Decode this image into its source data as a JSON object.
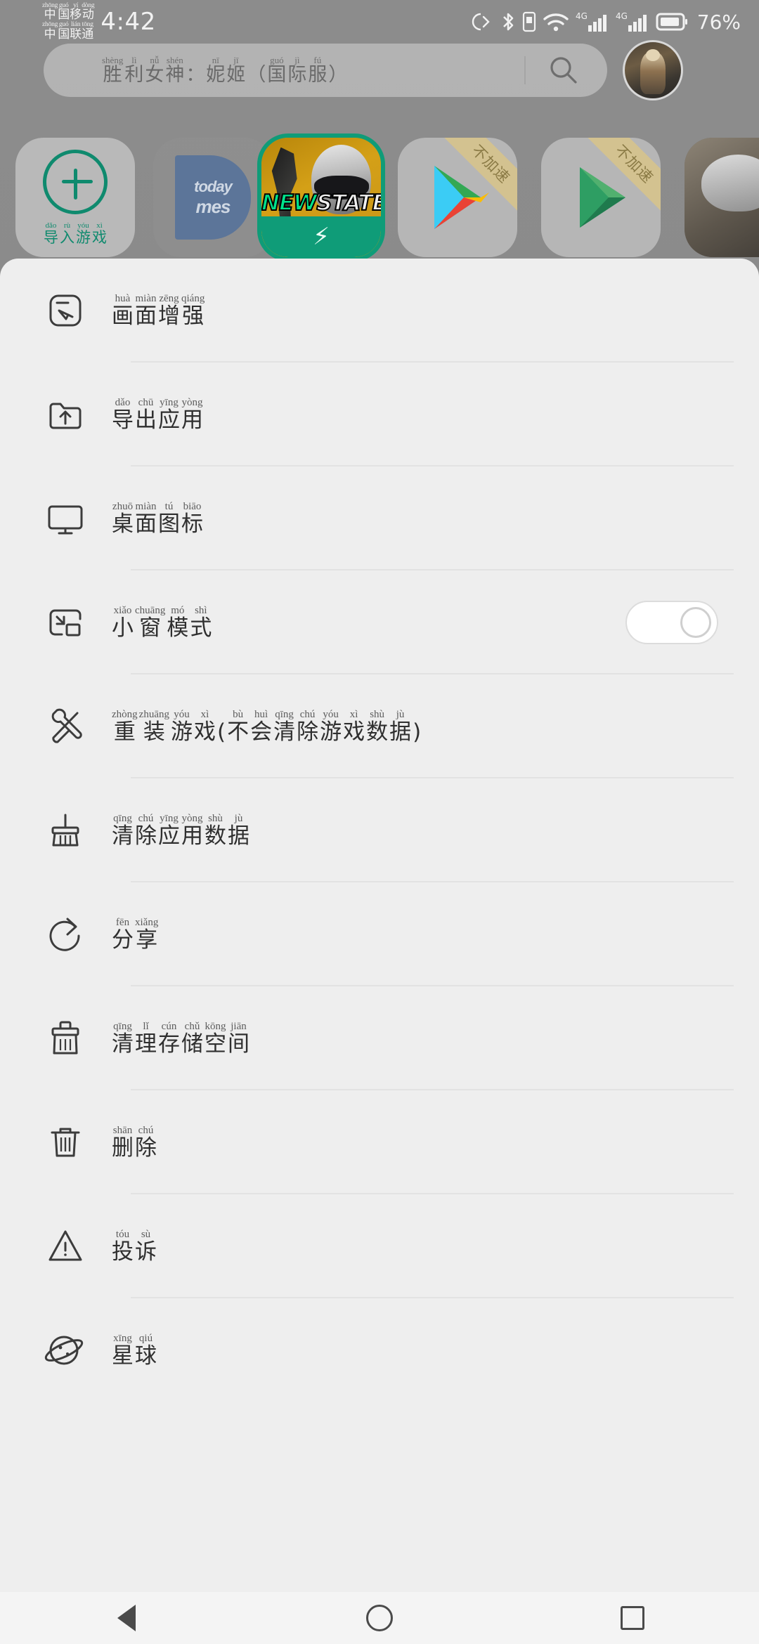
{
  "status_bar": {
    "carriers": [
      {
        "pinyin": [
          "zhōng",
          "guó",
          "yí",
          "dòng"
        ],
        "han": [
          "中",
          "国",
          "移",
          "动"
        ]
      },
      {
        "pinyin": [
          "zhōng",
          "guó",
          "lián",
          "tōng"
        ],
        "han": [
          "中",
          "国",
          "联",
          "通"
        ]
      }
    ],
    "time": "4:42",
    "battery_percent": "76%",
    "icons": [
      "do-not-disturb-icon",
      "bluetooth-icon",
      "wifi-icon",
      "signal-4g-1-icon",
      "signal-4g-2-icon",
      "battery-icon"
    ],
    "network_label": "4G"
  },
  "search": {
    "ruby": [
      {
        "py": "shèng",
        "han": "胜"
      },
      {
        "py": "lì",
        "han": "利"
      },
      {
        "py": "nǚ",
        "han": "女"
      },
      {
        "py": "shén",
        "han": "神"
      },
      {
        "py": "",
        "han": "："
      },
      {
        "py": "nī",
        "han": "妮"
      },
      {
        "py": "jī",
        "han": "姬"
      },
      {
        "py": "",
        "han": "（"
      },
      {
        "py": "guó",
        "han": "国"
      },
      {
        "py": "jì",
        "han": "际"
      },
      {
        "py": "fú",
        "han": "服"
      },
      {
        "py": "",
        "han": "）"
      }
    ],
    "full_text": "胜利女神：妮姬（国际服）",
    "search_icon": "search-icon",
    "avatar": "user-avatar"
  },
  "app_row": [
    {
      "name": "import-game",
      "type": "import",
      "label_ruby": [
        {
          "py": "dǎo",
          "han": "导"
        },
        {
          "py": "rù",
          "han": "入"
        },
        {
          "py": "yóu",
          "han": "游"
        },
        {
          "py": "xì",
          "han": "戏"
        }
      ],
      "label": "导入游戏",
      "accent": "#0f8a6e"
    },
    {
      "name": "today-games",
      "type": "today",
      "line1": "today",
      "line2": "mes",
      "label": ""
    },
    {
      "name": "new-state-game",
      "type": "newstate",
      "title_green": "NEW",
      "title_white": "STATE",
      "selected": true,
      "accent": "#0f9c78"
    },
    {
      "name": "google-play-store",
      "type": "play-store",
      "ribbon": "不加速"
    },
    {
      "name": "google-play-games",
      "type": "play-games",
      "ribbon": "不加速"
    },
    {
      "name": "partial-app",
      "type": "edge",
      "ribbon": ""
    }
  ],
  "menu": {
    "items": [
      {
        "name": "picture-enhance",
        "icon": "screen-enhance-icon",
        "ruby": [
          {
            "py": "huà",
            "han": "画"
          },
          {
            "py": "miàn",
            "han": "面"
          },
          {
            "py": "zēng",
            "han": "增"
          },
          {
            "py": "qiáng",
            "han": "强"
          }
        ],
        "label": "画面增强",
        "toggle": null
      },
      {
        "name": "export-app",
        "icon": "folder-upload-icon",
        "ruby": [
          {
            "py": "dǎo",
            "han": "导"
          },
          {
            "py": "chū",
            "han": "出"
          },
          {
            "py": "yīng",
            "han": "应"
          },
          {
            "py": "yòng",
            "han": "用"
          }
        ],
        "label": "导出应用",
        "toggle": null
      },
      {
        "name": "desktop-icon",
        "icon": "monitor-icon",
        "ruby": [
          {
            "py": "zhuō",
            "han": "桌"
          },
          {
            "py": "miàn",
            "han": "面"
          },
          {
            "py": "tú",
            "han": "图"
          },
          {
            "py": "biāo",
            "han": "标"
          }
        ],
        "label": "桌面图标",
        "toggle": null
      },
      {
        "name": "small-window-mode",
        "icon": "small-window-icon",
        "ruby": [
          {
            "py": "xiǎo",
            "han": "小"
          },
          {
            "py": "chuāng",
            "han": "窗"
          },
          {
            "py": "mó",
            "han": "模"
          },
          {
            "py": "shì",
            "han": "式"
          }
        ],
        "label": "小窗模式",
        "toggle": "off"
      },
      {
        "name": "reinstall-game",
        "icon": "wrench-icon",
        "ruby": [
          {
            "py": "zhòng",
            "han": "重"
          },
          {
            "py": "zhuāng",
            "han": "装"
          },
          {
            "py": "yóu",
            "han": "游"
          },
          {
            "py": "xì",
            "han": "戏"
          },
          {
            "py": "",
            "han": "("
          },
          {
            "py": "bù",
            "han": "不"
          },
          {
            "py": "huì",
            "han": "会"
          },
          {
            "py": "qīng",
            "han": "清"
          },
          {
            "py": "chú",
            "han": "除"
          },
          {
            "py": "yóu",
            "han": "游"
          },
          {
            "py": "xì",
            "han": "戏"
          },
          {
            "py": "shù",
            "han": "数"
          },
          {
            "py": "jù",
            "han": "据"
          },
          {
            "py": "",
            "han": ")"
          }
        ],
        "label": "重装游戏(不会清除游戏数据)",
        "toggle": null
      },
      {
        "name": "clear-app-data",
        "icon": "broom-icon",
        "ruby": [
          {
            "py": "qīng",
            "han": "清"
          },
          {
            "py": "chú",
            "han": "除"
          },
          {
            "py": "yīng",
            "han": "应"
          },
          {
            "py": "yòng",
            "han": "用"
          },
          {
            "py": "shù",
            "han": "数"
          },
          {
            "py": "jù",
            "han": "据"
          }
        ],
        "label": "清除应用数据",
        "toggle": null
      },
      {
        "name": "share",
        "icon": "share-icon",
        "ruby": [
          {
            "py": "fēn",
            "han": "分"
          },
          {
            "py": "xiǎng",
            "han": "享"
          }
        ],
        "label": "分享",
        "toggle": null
      },
      {
        "name": "clean-storage-space",
        "icon": "clean-storage-icon",
        "ruby": [
          {
            "py": "qīng",
            "han": "清"
          },
          {
            "py": "lǐ",
            "han": "理"
          },
          {
            "py": "cún",
            "han": "存"
          },
          {
            "py": "chǔ",
            "han": "储"
          },
          {
            "py": "kōng",
            "han": "空"
          },
          {
            "py": "jiān",
            "han": "间"
          }
        ],
        "label": "清理存储空间",
        "toggle": null
      },
      {
        "name": "delete",
        "icon": "trash-icon",
        "ruby": [
          {
            "py": "shān",
            "han": "删"
          },
          {
            "py": "chú",
            "han": "除"
          }
        ],
        "label": "删除",
        "toggle": null
      },
      {
        "name": "complaint",
        "icon": "warning-triangle-icon",
        "ruby": [
          {
            "py": "tóu",
            "han": "投"
          },
          {
            "py": "sù",
            "han": "诉"
          }
        ],
        "label": "投诉",
        "toggle": null
      },
      {
        "name": "planet",
        "icon": "planet-icon",
        "ruby": [
          {
            "py": "xīng",
            "han": "星"
          },
          {
            "py": "qiú",
            "han": "球"
          }
        ],
        "label": "星球",
        "toggle": null
      }
    ]
  },
  "nav_bar": {
    "buttons": [
      {
        "name": "nav-back-button",
        "icon": "triangle-back-icon"
      },
      {
        "name": "nav-home-button",
        "icon": "circle-home-icon"
      },
      {
        "name": "nav-recents-button",
        "icon": "square-recents-icon"
      }
    ]
  },
  "colors": {
    "accent_teal": "#0f8a6e",
    "sheet_bg": "#eeeeee",
    "backdrop": "#8b8b8b",
    "text_primary": "#2f2f2f",
    "text_pinyin": "#5c5c5c"
  }
}
